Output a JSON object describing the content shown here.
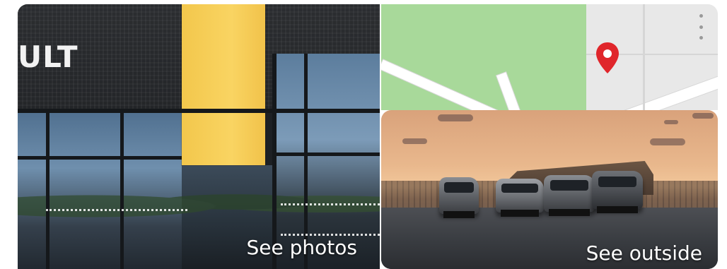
{
  "gallery": {
    "main_photo": {
      "label": "See photos",
      "brand_text": "ULT"
    },
    "map": {
      "pin_color": "#e0262b",
      "park_color": "#a8d99a",
      "menu_icon": "more-vert-icon"
    },
    "outside_photo": {
      "label": "See outside"
    }
  }
}
